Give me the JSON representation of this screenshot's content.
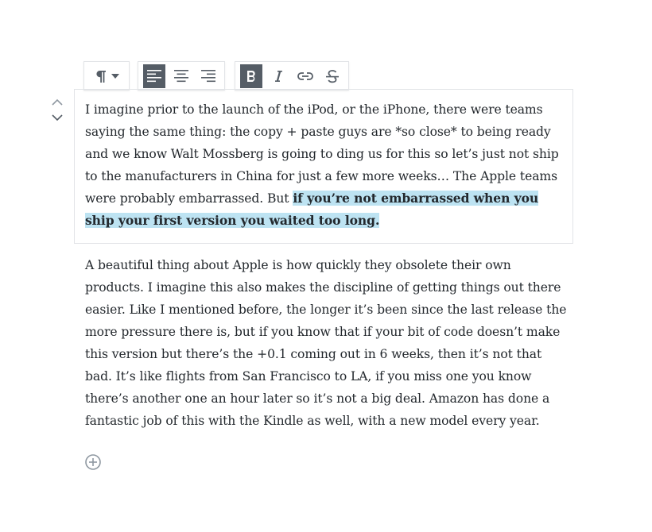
{
  "toolbar": {
    "block_type_icon": "paragraph-icon",
    "align": [
      {
        "name": "align-left",
        "active": true
      },
      {
        "name": "align-center",
        "active": false
      },
      {
        "name": "align-right",
        "active": false
      }
    ],
    "format": [
      {
        "name": "bold",
        "active": true
      },
      {
        "name": "italic",
        "active": false
      },
      {
        "name": "link",
        "active": false
      },
      {
        "name": "strikethrough",
        "active": false
      }
    ]
  },
  "blocks": {
    "paragraph_1": {
      "text_before": "I imagine prior to the launch of the iPod, or the iPhone, there were teams saying the same thing: the copy + paste guys are *so close* to being ready and we know Walt Mossberg is going to ding us for this so let’s just not ship to the manufacturers in China for just a few more weeks… The Apple teams were probably embarrassed. But ",
      "text_selected": "if you’re not embarrassed when you ship your first version you waited too long."
    },
    "paragraph_2": {
      "text": "A beautiful thing about Apple is how quickly they obsolete their own products. I imagine this also makes the discipline of getting things out there easier. Like I mentioned before, the longer it’s been since the last release the more pressure there is, but if you know that if your bit of code doesn’t make this version but there’s the +0.1 coming out in 6 weeks, then it’s not that bad. It’s like flights from San Francisco to LA, if you miss one you know there’s another one an hour later so it’s not a big deal. Amazon has done a fantastic job of this with the Kindle as well, with a new model every year."
    }
  },
  "colors": {
    "selection": "#bde3f2",
    "active_button": "#555d66",
    "border": "#e2e4e7",
    "text": "#23282d",
    "icon": "#555d66"
  }
}
